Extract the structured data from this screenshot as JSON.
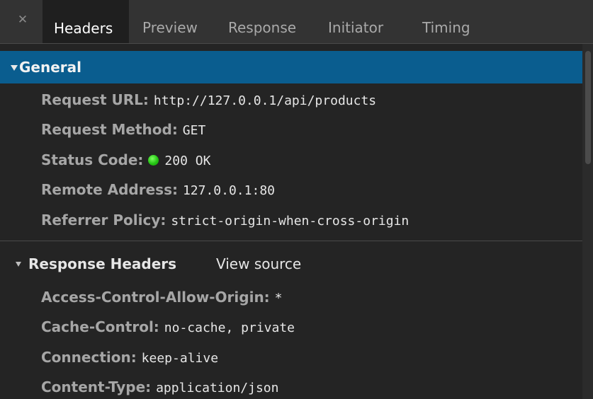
{
  "tabs": [
    {
      "label": "Headers",
      "active": true
    },
    {
      "label": "Preview",
      "active": false
    },
    {
      "label": "Response",
      "active": false
    },
    {
      "label": "Initiator",
      "active": false
    },
    {
      "label": "Timing",
      "active": false
    }
  ],
  "close_icon": "close-icon",
  "general": {
    "title": "General",
    "rows": [
      {
        "key": "Request URL:",
        "value": "http://127.0.0.1/api/products"
      },
      {
        "key": "Request Method:",
        "value": "GET"
      },
      {
        "key": "Status Code:",
        "value": "200 OK"
      },
      {
        "key": "Remote Address:",
        "value": "127.0.0.1:80"
      },
      {
        "key": "Referrer Policy:",
        "value": "strict-origin-when-cross-origin"
      }
    ]
  },
  "response_headers": {
    "title": "Response Headers",
    "view_source": "View source",
    "rows": [
      {
        "key": "Access-Control-Allow-Origin:",
        "value": "*"
      },
      {
        "key": "Cache-Control:",
        "value": "no-cache, private"
      },
      {
        "key": "Connection:",
        "value": "keep-alive"
      },
      {
        "key": "Content-Type:",
        "value": "application/json"
      }
    ]
  },
  "colors": {
    "section_highlight": "#0a5d8f",
    "status_ok": "#24c414",
    "background": "#242424"
  }
}
